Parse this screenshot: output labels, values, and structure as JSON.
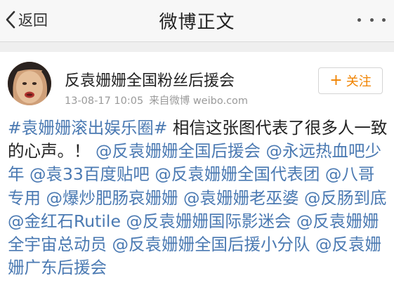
{
  "nav": {
    "back_label": "返回",
    "title": "微博正文",
    "back_icon": "chevron-left-icon",
    "more_icon": "more-dots-icon"
  },
  "post": {
    "author": "反袁姗姗全国粉丝后援会",
    "timestamp": "13-08-17 10:05",
    "source": "来自微博 weibo.com",
    "follow_label": "关注",
    "segments": [
      {
        "text": "#袁姗姗滚出娱乐圈#",
        "link": true
      },
      {
        "text": " 相信这张图代表了很多人一致的心声。！ ",
        "link": false
      },
      {
        "text": "@反袁姗姗全国后援会",
        "link": true
      },
      {
        "text": " ",
        "link": false
      },
      {
        "text": "@永远热血吧少年",
        "link": true
      },
      {
        "text": " ",
        "link": false
      },
      {
        "text": "@袁33百度贴吧",
        "link": true
      },
      {
        "text": " ",
        "link": false
      },
      {
        "text": "@反袁姗姗全国代表团",
        "link": true
      },
      {
        "text": " ",
        "link": false
      },
      {
        "text": "@八哥专用",
        "link": true
      },
      {
        "text": " ",
        "link": false
      },
      {
        "text": "@爆炒肥肠哀姗姗",
        "link": true
      },
      {
        "text": " ",
        "link": false
      },
      {
        "text": "@袁姗姗老巫婆",
        "link": true
      },
      {
        "text": " ",
        "link": false
      },
      {
        "text": "@反肠到底",
        "link": true
      },
      {
        "text": " ",
        "link": false
      },
      {
        "text": "@金红石Rutile",
        "link": true
      },
      {
        "text": " ",
        "link": false
      },
      {
        "text": "@反袁姗姗国际影迷会",
        "link": true
      },
      {
        "text": " ",
        "link": false
      },
      {
        "text": "@反袁姗姗全宇宙总动员",
        "link": true
      },
      {
        "text": " ",
        "link": false
      },
      {
        "text": "@反袁姗姗全国后援小分队",
        "link": true
      },
      {
        "text": " ",
        "link": false
      },
      {
        "text": "@反袁姗姗广东后援会",
        "link": true
      }
    ]
  },
  "colors": {
    "link": "#4a79b2",
    "accent": "#f08300",
    "meta": "#9a9a9a",
    "nav_bg": "#f7f7f7"
  }
}
